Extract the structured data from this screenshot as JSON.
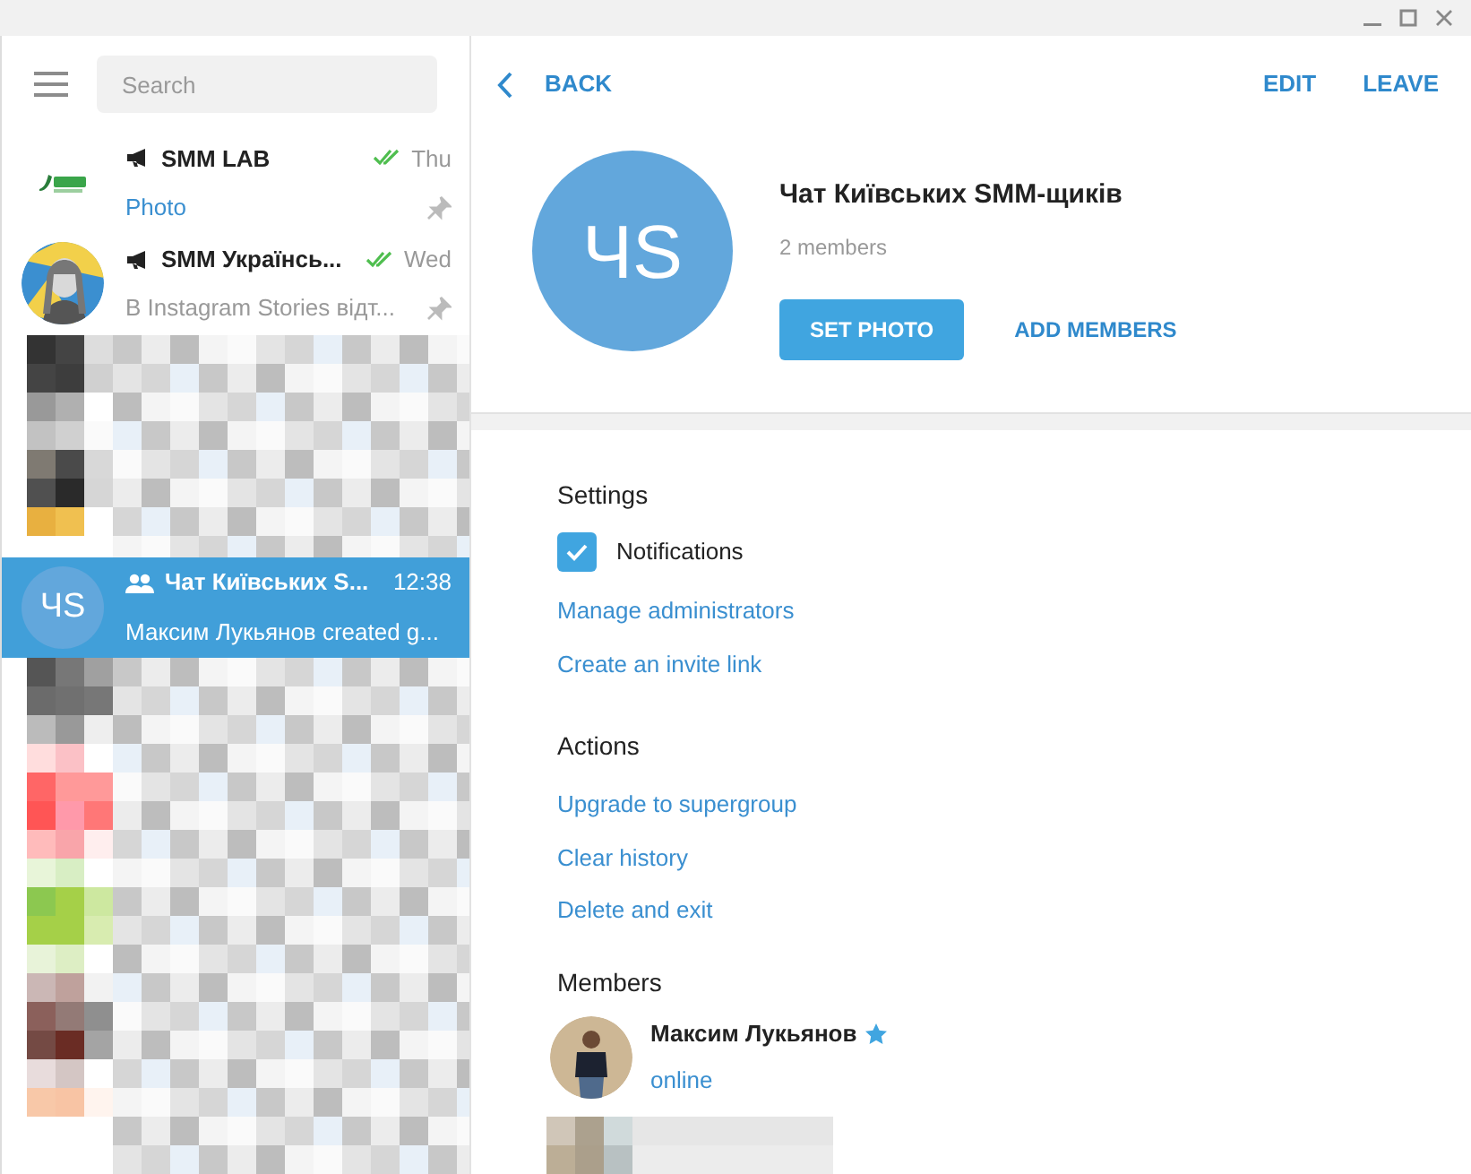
{
  "sidebar": {
    "search": {
      "placeholder": "Search"
    },
    "chats": [
      {
        "kind": "channel",
        "avatar": {
          "kind": "logo"
        },
        "name": "SMM LAB",
        "time": "Thu",
        "read": true,
        "preview": "Photo",
        "media": true,
        "pinned": true,
        "selected": false
      },
      {
        "kind": "channel",
        "name": "SMM Українсь...",
        "time": "Wed",
        "read": true,
        "preview": "В Instagram Stories відт...",
        "media": false,
        "pinned": true,
        "selected": false
      },
      {
        "kind": "group",
        "avatar": {
          "kind": "initials",
          "initials": "ЧS"
        },
        "name": "Чат Київських S...",
        "time": "12:38",
        "read": false,
        "preview": "Максим Лукьянов created g...",
        "pinned": false,
        "selected": true
      }
    ]
  },
  "header": {
    "back": "BACK",
    "actions": [
      "EDIT",
      "LEAVE"
    ]
  },
  "group": {
    "initials": "ЧS",
    "title": "Чат Київських SMM-щиків",
    "subtitle": "2 members",
    "primary_button": "SET PHOTO",
    "secondary_button": "ADD MEMBERS"
  },
  "settings": {
    "title": "Settings",
    "notifications": {
      "label": "Notifications",
      "checked": true
    },
    "links": [
      "Manage administrators",
      "Create an invite link"
    ]
  },
  "actions": {
    "title": "Actions",
    "links": [
      "Upgrade to supergroup",
      "Clear history",
      "Delete and exit"
    ]
  },
  "members": {
    "title": "Members",
    "items": [
      {
        "name": "Максим Лукьянов",
        "admin": true,
        "status": "online"
      }
    ]
  }
}
